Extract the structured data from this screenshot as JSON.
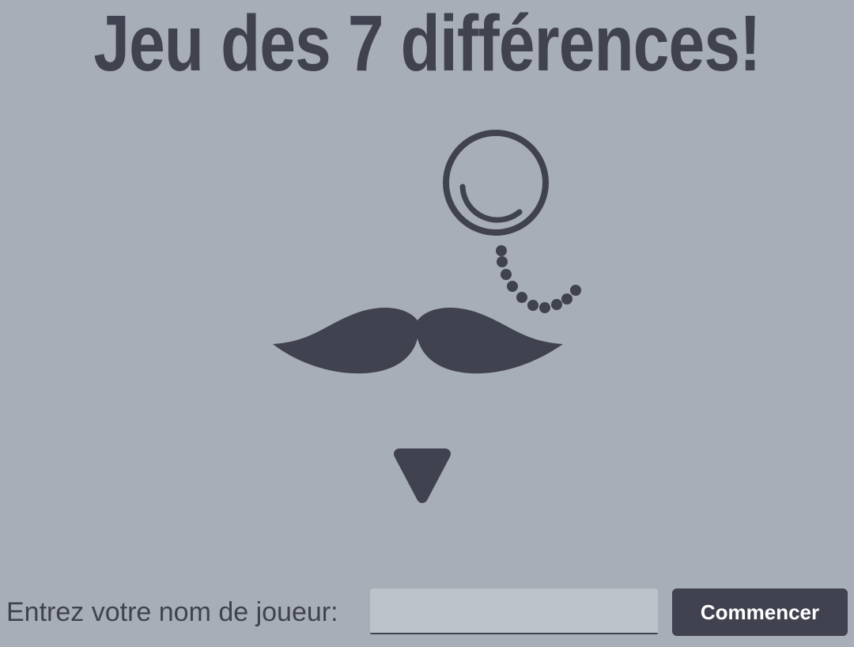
{
  "header": {
    "title": "Jeu des 7 différences!"
  },
  "illustration": {
    "icons": [
      "monocle-icon",
      "monocle-chain-icon",
      "mustache-icon",
      "goatee-icon"
    ],
    "color": "#41424f"
  },
  "form": {
    "name_label": "Entrez votre nom de joueur:",
    "name_value": "",
    "name_placeholder": "",
    "start_label": "Commencer"
  },
  "colors": {
    "background": "#a7aeb7",
    "primary": "#41424f",
    "input_background": "#bdc3ca",
    "button_text": "#ffffff"
  }
}
